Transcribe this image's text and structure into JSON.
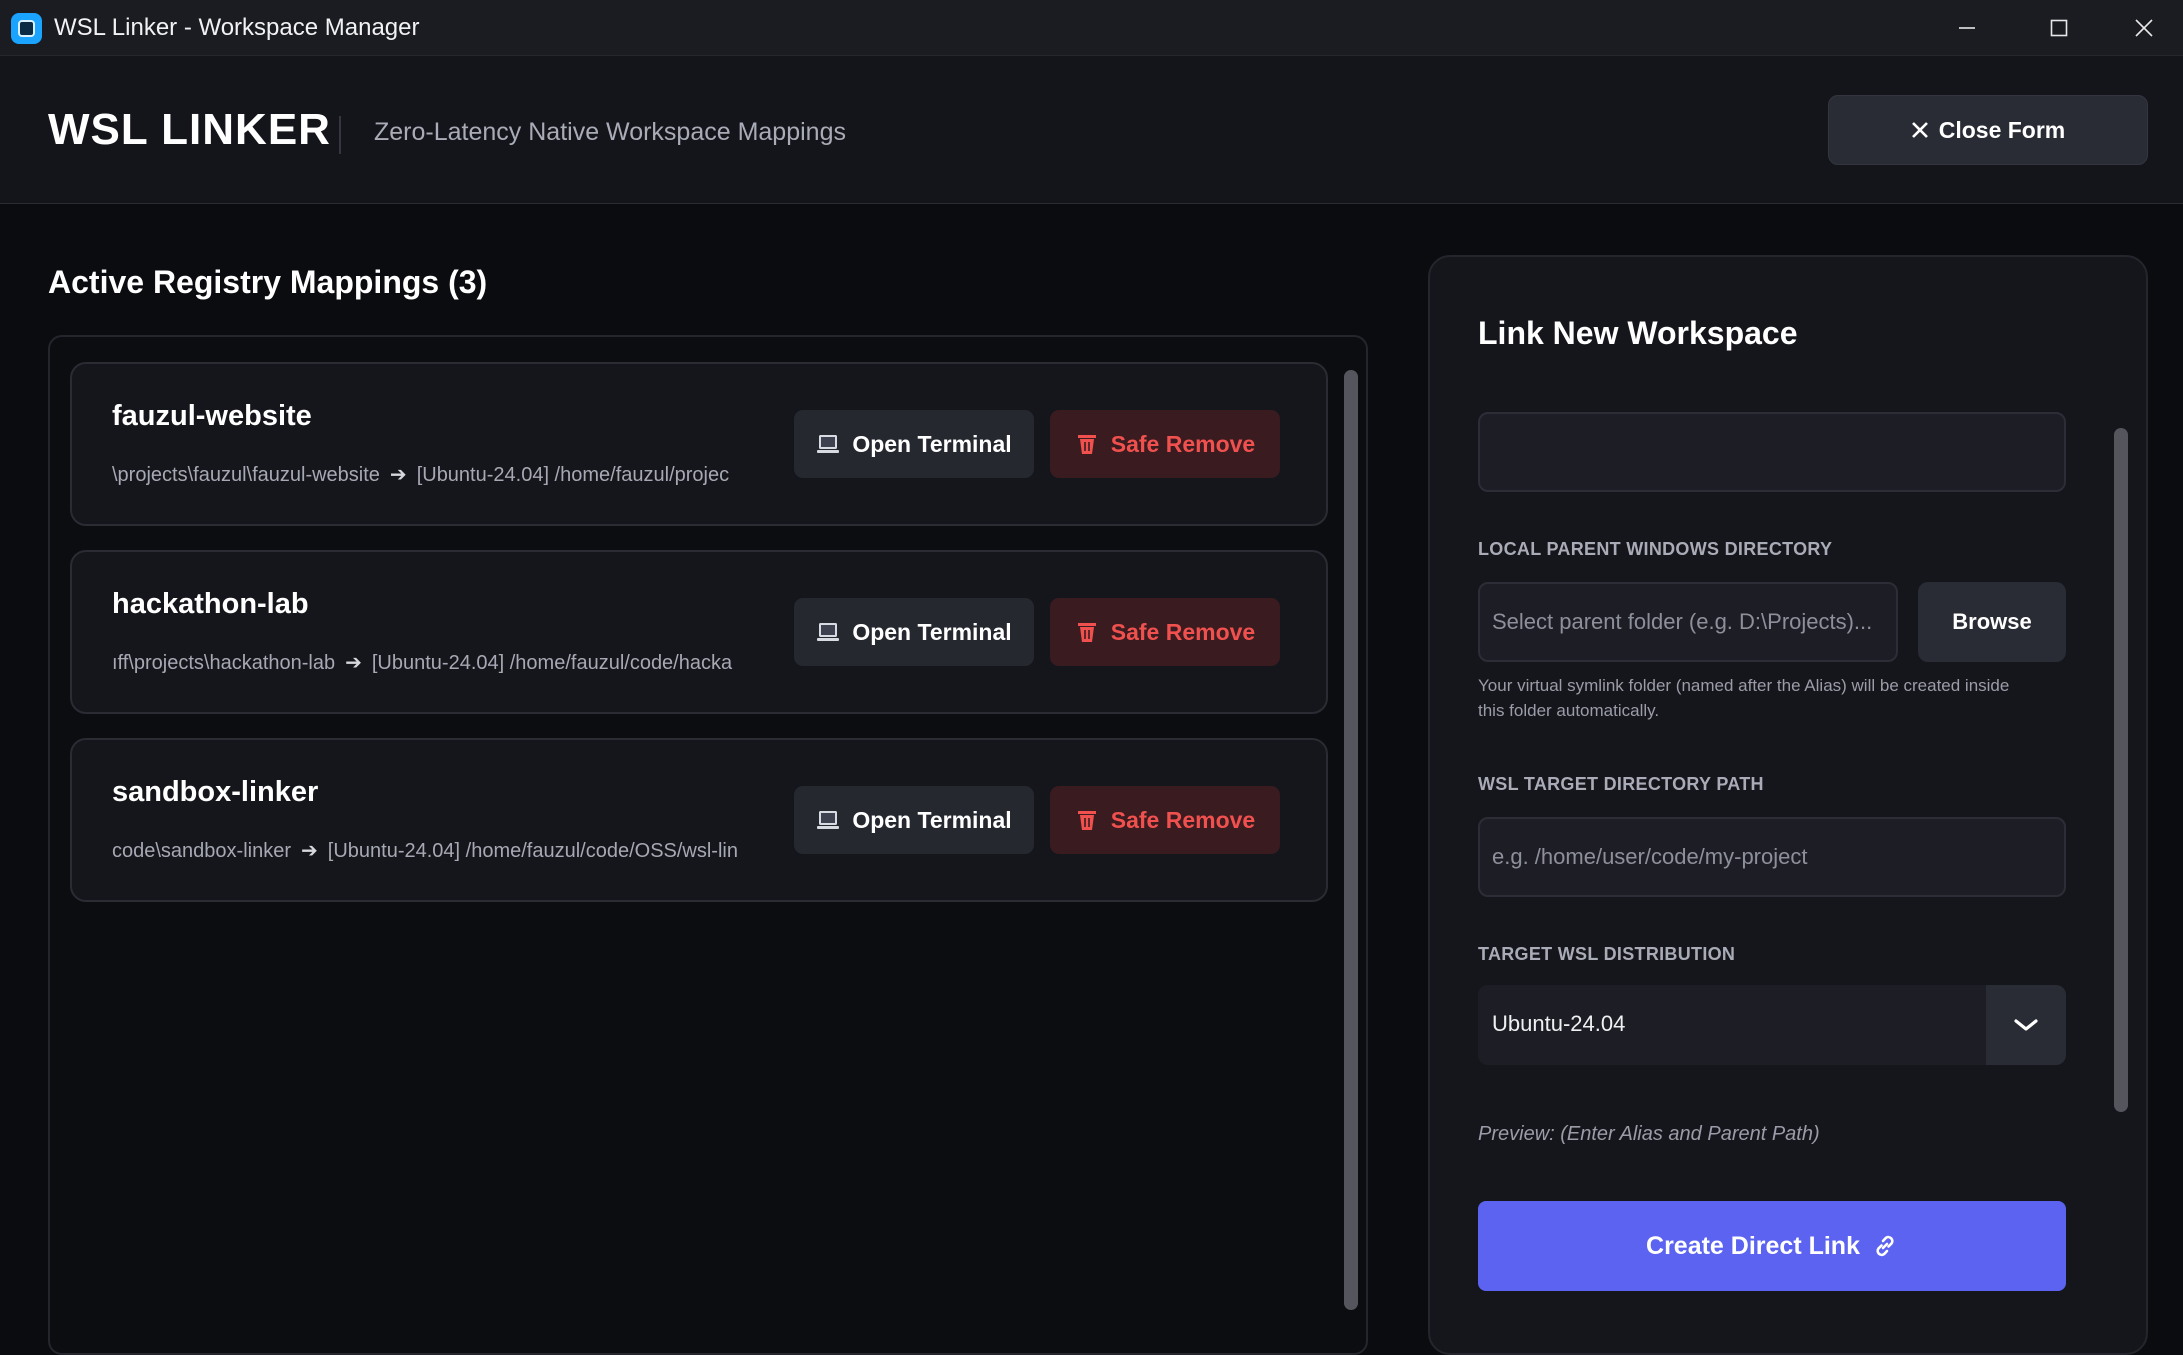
{
  "window": {
    "title": "WSL Linker - Workspace Manager",
    "icon": "app-icon",
    "controls": [
      "minimize-icon",
      "maximize-icon",
      "close-icon"
    ]
  },
  "header": {
    "brand": "WSL LINKER",
    "tagline": "Zero-Latency Native Workspace Mappings",
    "close_form_label": "Close Form"
  },
  "registry": {
    "title": "Active Registry Mappings (3)",
    "open_terminal_label": "Open Terminal",
    "safe_remove_label": "Safe Remove",
    "mappings": [
      {
        "name": "fauzul-website",
        "windows_path": "\\projects\\fauzul\\fauzul-website",
        "wsl_path": "[Ubuntu-24.04] /home/fauzul/projec"
      },
      {
        "name": "hackathon-lab",
        "windows_path": "ıff\\projects\\hackathon-lab",
        "wsl_path": "[Ubuntu-24.04] /home/fauzul/code/hacka"
      },
      {
        "name": "sandbox-linker",
        "windows_path": "code\\sandbox-linker",
        "wsl_path": "[Ubuntu-24.04] /home/fauzul/code/OSS/wsl-lin"
      }
    ]
  },
  "form": {
    "title": "Link New Workspace",
    "alias_value": "",
    "parent_label": "LOCAL PARENT WINDOWS DIRECTORY",
    "parent_placeholder": "Select parent folder (e.g. D:\\Projects)...",
    "browse_label": "Browse",
    "helper": "Your virtual symlink folder (named after the Alias) will be created inside this folder automatically.",
    "wsl_label": "WSL TARGET DIRECTORY PATH",
    "wsl_placeholder": "e.g. /home/user/code/my-project",
    "distro_label": "TARGET WSL DISTRIBUTION",
    "distro_value": "Ubuntu-24.04",
    "preview": "Preview: (Enter Alias and Parent Path)",
    "create_label": "Create Direct Link"
  },
  "colors": {
    "accent": "#5b63f0",
    "danger": "#f0514f",
    "danger_bg": "#3a1b1f",
    "panel": "#15161c",
    "background": "#0b0c10"
  }
}
